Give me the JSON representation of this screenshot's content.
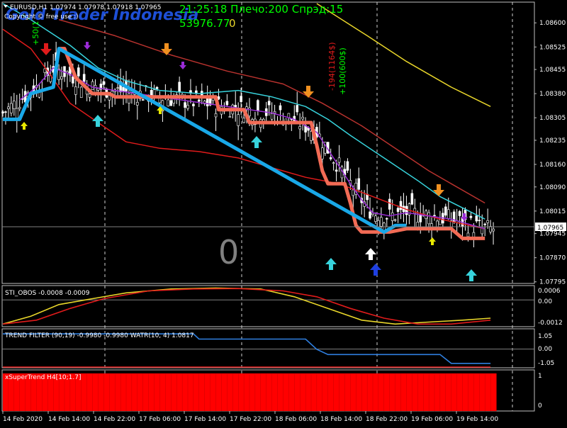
{
  "header": {
    "symbol_line": "EURUSD,H1  1.07974 1.07978 1.07918 1.07965",
    "copyright": "Copyright © free use :)",
    "watermark": "Gold Trader Indonesia",
    "clock": "21:25:18 Плечо:200 Спрэд:15",
    "balance": "53976.77",
    "balance_zero": "0",
    "vertical_left": "+50(1",
    "vertical_red": "-194(1164$)",
    "vertical_green": "+100(600$)",
    "big_zero": "0"
  },
  "colors": {
    "background": "#000000",
    "text": "#ffffff",
    "green_text": "#00ff00",
    "watermark": "#1e4fd6",
    "supertrend_up": "#19a8e8",
    "supertrend_down": "#f26b55",
    "ma_yellow": "#e8d52a",
    "ma_brown": "#b8322e",
    "ma_cyan": "#37d3dc",
    "ma_red": "#e01b1b",
    "ma_purple": "#9a2bd6",
    "price_line": "#808080"
  },
  "chart_data": [
    {
      "type": "line",
      "panel": "price",
      "title": "EURUSD,H1",
      "price_axis_labels": [
        "1.08600",
        "1.08525",
        "1.08455",
        "1.08380",
        "1.08305",
        "1.08235",
        "1.08160",
        "1.08090",
        "1.08015",
        "1.07945",
        "1.07870",
        "1.07795"
      ],
      "current_price": "1.07965",
      "ylim": [
        1.0779,
        1.0866
      ],
      "time_labels": [
        "14 Feb 2020",
        "14 Feb 14:00",
        "14 Feb 22:00",
        "17 Feb 06:00",
        "17 Feb 14:00",
        "17 Feb 22:00",
        "18 Feb 06:00",
        "18 Feb 14:00",
        "18 Feb 22:00",
        "19 Feb 06:00",
        "19 Feb 14:00"
      ],
      "x_range": [
        0,
        88
      ],
      "series": [
        {
          "color": "#e8d52a",
          "points": [
            [
              56,
              1.0866
            ],
            [
              65,
              1.0856
            ],
            [
              72,
              1.0848
            ],
            [
              80,
              1.084
            ],
            [
              87,
              1.0834
            ]
          ]
        },
        {
          "color": "#b8322e",
          "points": [
            [
              10,
              1.0861
            ],
            [
              20,
              1.0856
            ],
            [
              30,
              1.085
            ],
            [
              40,
              1.0845
            ],
            [
              50,
              1.0841
            ],
            [
              57,
              1.0835
            ],
            [
              64,
              1.0828
            ],
            [
              70,
              1.0821
            ],
            [
              76,
              1.0814
            ],
            [
              80,
              1.081
            ],
            [
              86,
              1.0804
            ]
          ]
        },
        {
          "color": "#37d3dc",
          "points": [
            [
              0,
              1.0866
            ],
            [
              5,
              1.0861
            ],
            [
              12,
              1.0853
            ],
            [
              17,
              1.0846
            ],
            [
              22,
              1.0842
            ],
            [
              28,
              1.0839
            ],
            [
              35,
              1.0838
            ],
            [
              42,
              1.0839
            ],
            [
              48,
              1.0837
            ],
            [
              54,
              1.0834
            ],
            [
              58,
              1.083
            ],
            [
              62,
              1.0825
            ],
            [
              68,
              1.0818
            ],
            [
              74,
              1.0811
            ],
            [
              78,
              1.0806
            ],
            [
              86,
              1.0799
            ]
          ]
        },
        {
          "color": "#e01b1b",
          "points": [
            [
              0,
              1.0858
            ],
            [
              5,
              1.0852
            ],
            [
              8,
              1.0845
            ],
            [
              12,
              1.0835
            ],
            [
              17,
              1.0829
            ],
            [
              22,
              1.0823
            ],
            [
              28,
              1.0821
            ],
            [
              35,
              1.082
            ],
            [
              42,
              1.0818
            ],
            [
              48,
              1.0815
            ],
            [
              54,
              1.0812
            ],
            [
              60,
              1.081
            ],
            [
              66,
              1.0806
            ],
            [
              72,
              1.0802
            ],
            [
              78,
              1.0799
            ],
            [
              86,
              1.0796
            ]
          ]
        },
        {
          "color": "#9a2bd6",
          "points": [
            [
              3,
              1.0836
            ],
            [
              6,
              1.084
            ],
            [
              9,
              1.0846
            ],
            [
              12,
              1.0844
            ],
            [
              16,
              1.084
            ],
            [
              20,
              1.0839
            ],
            [
              24,
              1.0838
            ],
            [
              28,
              1.0837
            ],
            [
              32,
              1.0836
            ],
            [
              36,
              1.0835
            ],
            [
              40,
              1.0834
            ],
            [
              44,
              1.0833
            ],
            [
              48,
              1.0832
            ],
            [
              52,
              1.083
            ],
            [
              56,
              1.0826
            ],
            [
              59,
              1.0818
            ],
            [
              62,
              1.081
            ],
            [
              64,
              1.0805
            ],
            [
              66,
              1.0801
            ],
            [
              69,
              1.08
            ],
            [
              72,
              1.0801
            ],
            [
              76,
              1.08
            ],
            [
              80,
              1.0799
            ],
            [
              84,
              1.0797
            ],
            [
              86,
              1.0796
            ]
          ]
        },
        {
          "color": "#f26b55",
          "width": 5,
          "points": [
            [
              10,
              1.0852
            ],
            [
              11,
              1.0852
            ],
            [
              13,
              1.0843
            ],
            [
              16,
              1.0838
            ],
            [
              19,
              1.0838
            ],
            [
              20,
              1.0837
            ],
            [
              38,
              1.0837
            ],
            [
              38.5,
              1.0833
            ],
            [
              43,
              1.0833
            ],
            [
              44,
              1.0829
            ],
            [
              55,
              1.0829
            ],
            [
              56,
              1.0822
            ],
            [
              57,
              1.0814
            ],
            [
              58,
              1.081
            ],
            [
              61,
              1.081
            ],
            [
              62,
              1.0804
            ],
            [
              63,
              1.0797
            ],
            [
              64,
              1.0795
            ],
            [
              69,
              1.0795
            ],
            [
              72,
              1.0796
            ],
            [
              80,
              1.0796
            ],
            [
              82,
              1.0793
            ],
            [
              86,
              1.0793
            ]
          ]
        },
        {
          "color": "#19a8e8",
          "width": 5,
          "points": [
            [
              0,
              1.083
            ],
            [
              3,
              1.083
            ],
            [
              5,
              1.0838
            ],
            [
              9,
              1.084
            ],
            [
              10,
              1.0852
            ],
            [
              68,
              1.0795
            ],
            [
              70,
              1.0797
            ],
            [
              72,
              1.0797
            ]
          ]
        }
      ]
    },
    {
      "type": "line",
      "panel": "STI_OBOS",
      "title": "STI_OBOS -0.0008 -0.0009",
      "axis_labels": [
        "0.0006",
        "0.00",
        "-0.0012"
      ],
      "ylim": [
        -0.0013,
        0.0007
      ],
      "x_range": [
        0,
        88
      ],
      "series": [
        {
          "color": "#e8d52a",
          "values": [
            [
              0,
              -0.0012
            ],
            [
              5,
              -0.0008
            ],
            [
              10,
              -0.0002
            ],
            [
              16,
              0.0001
            ],
            [
              22,
              0.0004
            ],
            [
              30,
              0.0006
            ],
            [
              38,
              0.00065
            ],
            [
              46,
              0.0006
            ],
            [
              52,
              0.0002
            ],
            [
              58,
              -0.0004
            ],
            [
              64,
              -0.001
            ],
            [
              70,
              -0.0012
            ],
            [
              76,
              -0.0011
            ],
            [
              82,
              -0.001
            ],
            [
              87,
              -0.0009
            ]
          ]
        },
        {
          "color": "#e01b1b",
          "values": [
            [
              0,
              -0.0012
            ],
            [
              6,
              -0.001
            ],
            [
              12,
              -0.0004
            ],
            [
              18,
              0.0001
            ],
            [
              26,
              0.0005
            ],
            [
              34,
              0.0006
            ],
            [
              42,
              0.00062
            ],
            [
              50,
              0.0005
            ],
            [
              56,
              0.0002
            ],
            [
              62,
              -0.0004
            ],
            [
              68,
              -0.0009
            ],
            [
              74,
              -0.0012
            ],
            [
              80,
              -0.0012
            ],
            [
              87,
              -0.001
            ]
          ]
        }
      ]
    },
    {
      "type": "line",
      "panel": "TREND FILTER",
      "title": "TREND FILTER (90,19) -0.9980 -0.9980  WATR(10, 4) 1.0817",
      "axis_labels": [
        "1.05",
        "0.00",
        "-1.05"
      ],
      "ylim": [
        -1.2,
        1.3
      ],
      "x_range": [
        0,
        88
      ],
      "series": [
        {
          "color": "#2f7fe0",
          "values": [
            [
              0,
              1.05
            ],
            [
              34,
              1.05
            ],
            [
              35,
              0.7
            ],
            [
              54,
              0.7
            ],
            [
              56,
              0.0
            ],
            [
              58,
              -0.35
            ],
            [
              78,
              -0.35
            ],
            [
              80,
              -0.95
            ],
            [
              87,
              -0.95
            ]
          ]
        },
        {
          "color": "#e01b1b",
          "values": [
            [
              0,
              -1.2
            ],
            [
              87,
              -1.2
            ]
          ]
        }
      ]
    },
    {
      "type": "bar",
      "panel": "xSuperTrend",
      "title": "xSuperTrend H4[10;1.7]",
      "axis_labels": [
        "1",
        "0"
      ],
      "ylim": [
        0,
        1
      ],
      "values_all": 1,
      "bar_count": 88,
      "color": "#ff0000"
    }
  ]
}
